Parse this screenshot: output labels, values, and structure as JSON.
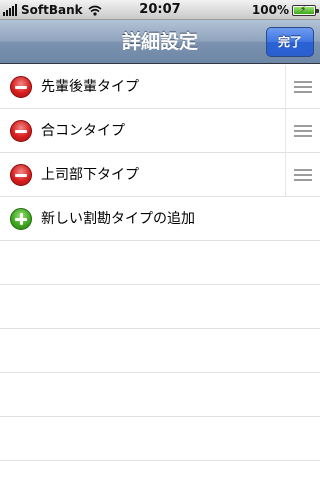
{
  "status_bar": {
    "carrier": "SoftBank",
    "time": "20:07",
    "battery": "100%"
  },
  "nav": {
    "title": "詳細設定",
    "done_label": "完了"
  },
  "rows": [
    {
      "label": "先輩後輩タイプ",
      "action": "delete"
    },
    {
      "label": "合コンタイプ",
      "action": "delete"
    },
    {
      "label": "上司部下タイプ",
      "action": "delete"
    }
  ],
  "add_row": {
    "label": "新しい割勘タイプの追加"
  },
  "colors": {
    "nav_bar": "#8ea3bd",
    "done_button": "#3f74e0",
    "delete_icon": "#d81f1f",
    "add_icon": "#3fa91f"
  }
}
